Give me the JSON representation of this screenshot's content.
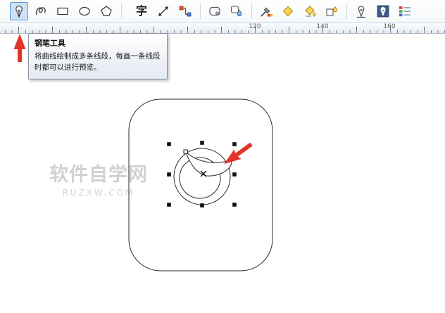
{
  "tooltip": {
    "title": "钢笔工具",
    "body": "将曲线绘制成多条线段，每画一条线段时都可以进行预览。"
  },
  "toolbar": {
    "text_tool_label": "字",
    "tools": [
      {
        "id": "pen-tool",
        "icon": "pen-nib",
        "selected": true
      },
      {
        "id": "freehand-curve-tool",
        "icon": "squiggle",
        "selected": false
      },
      {
        "id": "rectangle-tool",
        "icon": "rectangle-outline",
        "selected": false
      },
      {
        "id": "ellipse-tool",
        "icon": "ellipse-outline",
        "selected": false
      },
      {
        "id": "polygon-tool",
        "icon": "polygon-outline",
        "selected": false
      },
      {
        "id": "text-tool",
        "icon": "cjk-character",
        "selected": false
      },
      {
        "id": "dimension-tool",
        "icon": "diagonal-double-arrow",
        "selected": false
      },
      {
        "id": "connector-tool",
        "icon": "connected-squares",
        "selected": false
      },
      {
        "id": "shape-tool",
        "icon": "rounded-rectangle",
        "selected": false
      },
      {
        "id": "drop-shadow-tool",
        "icon": "rect-with-blue-drop",
        "selected": false
      },
      {
        "id": "eyedropper-tool",
        "icon": "eyedropper-with-swatches",
        "selected": false
      },
      {
        "id": "smart-fill-tool",
        "icon": "yellow-diamond",
        "selected": false
      },
      {
        "id": "paint-bucket-tool",
        "icon": "yellow-bucket",
        "selected": false
      },
      {
        "id": "fill-tool",
        "icon": "square-with-yellow-drop",
        "selected": false
      },
      {
        "id": "outline-pen-tool",
        "icon": "pen-nib-outline",
        "selected": false
      },
      {
        "id": "artistic-pen-tool",
        "icon": "pen-nib-dark-panel",
        "selected": false
      },
      {
        "id": "color-palette-tool",
        "icon": "rgb-color-grid",
        "selected": false
      }
    ]
  },
  "ruler": {
    "labels": [
      {
        "text": "120"
      },
      {
        "text": "140"
      },
      {
        "text": "160"
      }
    ]
  },
  "watermark": {
    "title": "软件自学网",
    "subtitle": "RUZXW.COM"
  },
  "colors": {
    "selection_blue": "#5b9bd5",
    "selection_fill": "#cde2f7",
    "annotation_arrow_red": "#e3342a",
    "outline_black": "#2a2a2a"
  }
}
